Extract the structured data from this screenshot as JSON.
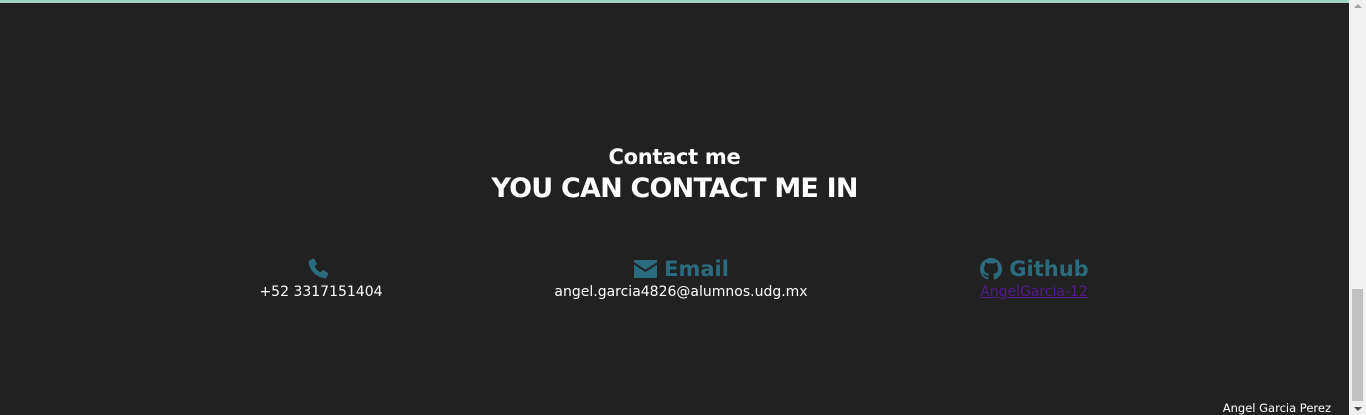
{
  "contact": {
    "subtitle": "Contact me",
    "title": "YOU CAN CONTACT ME IN",
    "phone": {
      "icon": "phone-icon",
      "label": "",
      "value": "+52 3317151404"
    },
    "email": {
      "icon": "envelope-icon",
      "label": "Email",
      "value": "angel.garcia4826@alumnos.udg.mx"
    },
    "github": {
      "icon": "github-icon",
      "label": "Github",
      "link_text": "AngelGarcia-12"
    }
  },
  "footer": {
    "credit": "Angel Garcia Perez"
  },
  "colors": {
    "background": "#212121",
    "accent": "#2a6b7e",
    "visited_link": "#551a8b",
    "top_strip": "#9ed3c0"
  }
}
